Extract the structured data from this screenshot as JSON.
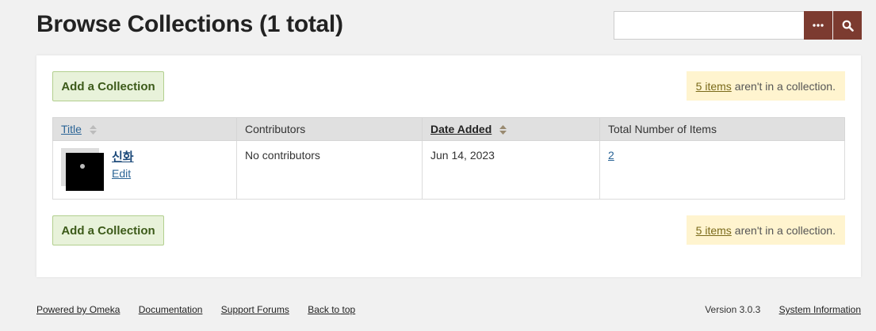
{
  "header": {
    "title": "Browse Collections (1 total)"
  },
  "search": {
    "placeholder": "",
    "options_icon": "ellipsis-icon",
    "submit_icon": "search-icon"
  },
  "toolbar": {
    "add_label": "Add a Collection",
    "notice_link": "5 items",
    "notice_text": "aren't in a collection."
  },
  "table": {
    "columns": [
      {
        "label": "Title",
        "sortable": true
      },
      {
        "label": "Contributors",
        "sortable": false
      },
      {
        "label": "Date Added",
        "sortable": true
      },
      {
        "label": "Total Number of Items",
        "sortable": false
      }
    ],
    "rows": [
      {
        "title": "신화",
        "edit_label": "Edit",
        "contributors": "No contributors",
        "date_added": "Jun 14, 2023",
        "item_count": "2"
      }
    ]
  },
  "footer": {
    "links": [
      "Powered by Omeka",
      "Documentation",
      "Support Forums",
      "Back to top"
    ],
    "version": "Version 3.0.3",
    "system_info": "System Information"
  },
  "colors": {
    "accent": "#7c3b30",
    "add_button_bg": "#e8f2da",
    "notice_bg": "#fff4cf"
  }
}
